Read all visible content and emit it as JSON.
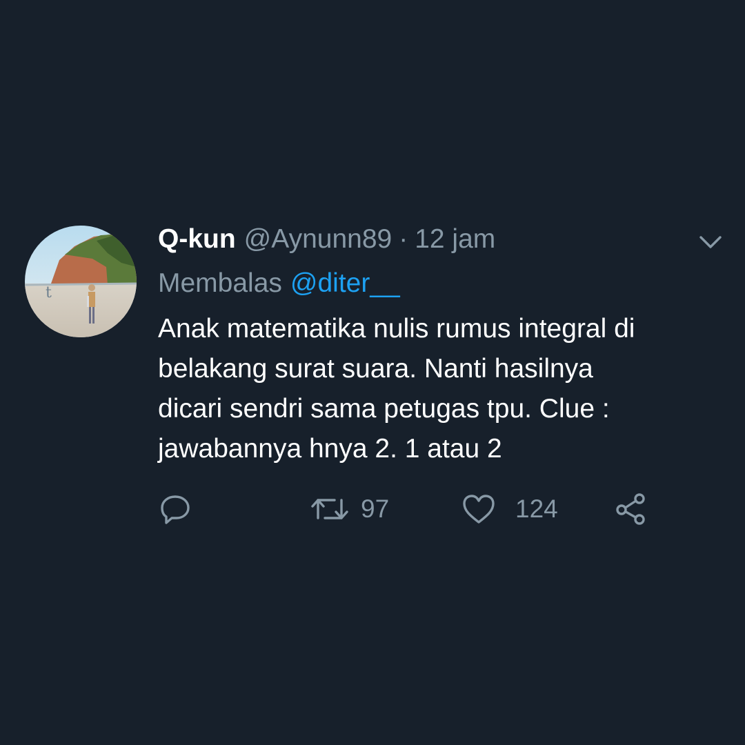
{
  "tweet": {
    "author": {
      "display_name": "Q-kun",
      "username": "@Aynunn89",
      "separator": "·",
      "timestamp": "12 jam"
    },
    "reply": {
      "prefix": "Membalas",
      "handle": "@diter__"
    },
    "body_lines": [
      "Anak matematika nulis rumus integral di",
      "belakang surat suara. Nanti hasilnya",
      "dicari sendri sama petugas tpu. Clue :",
      "jawabannya hnya 2. 1 atau 2"
    ],
    "stats": {
      "retweets": "97",
      "likes": "124"
    }
  },
  "icons": {
    "reply": "speech-bubble-icon",
    "retweet": "retweet-icon",
    "like": "heart-icon",
    "share": "share-icon",
    "menu": "chevron-down-icon"
  },
  "colors": {
    "background": "#17202b",
    "primary_text": "#ffffff",
    "secondary_text": "#8899a6",
    "link": "#1da1f2"
  }
}
